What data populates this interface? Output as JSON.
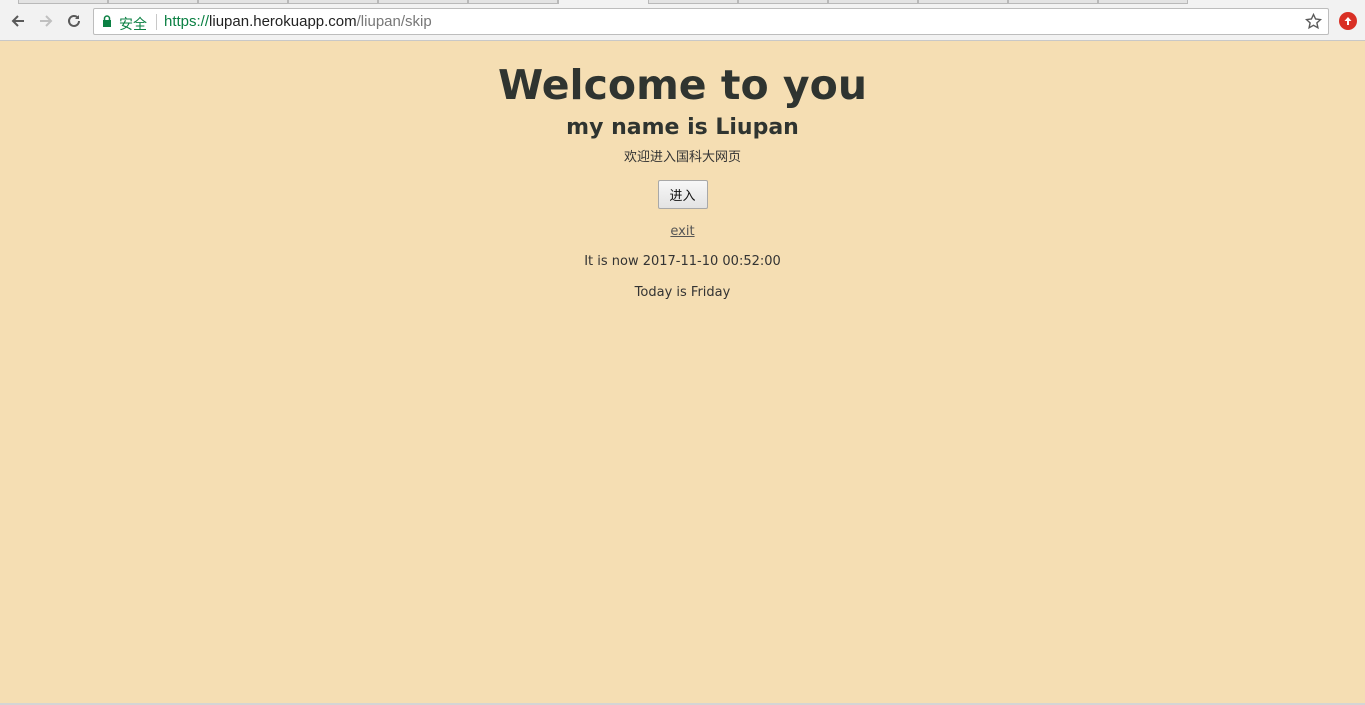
{
  "browser": {
    "tab_count": 13,
    "active_tab_index": 6,
    "security_label": "安全",
    "url": {
      "scheme": "https://",
      "host": "liupan.herokuapp.com",
      "path": "/liupan/skip"
    },
    "icons": {
      "back": "arrow-left-icon",
      "forward": "arrow-right-icon",
      "reload": "reload-icon",
      "lock": "lock-icon",
      "bookmark": "star-icon",
      "extension": "upload-extension-icon"
    },
    "colors": {
      "secure_green": "#0b8043",
      "extension_red": "#d93025"
    }
  },
  "page": {
    "background": "#f5deb3",
    "title": "Welcome to you",
    "subtitle": "my name is Liupan",
    "welcome_cn": "欢迎进入国科大网页",
    "enter_button": "进入",
    "exit_link": "exit",
    "now_text": "It is now 2017-11-10 00:52:00",
    "today_text": "Today is Friday"
  }
}
